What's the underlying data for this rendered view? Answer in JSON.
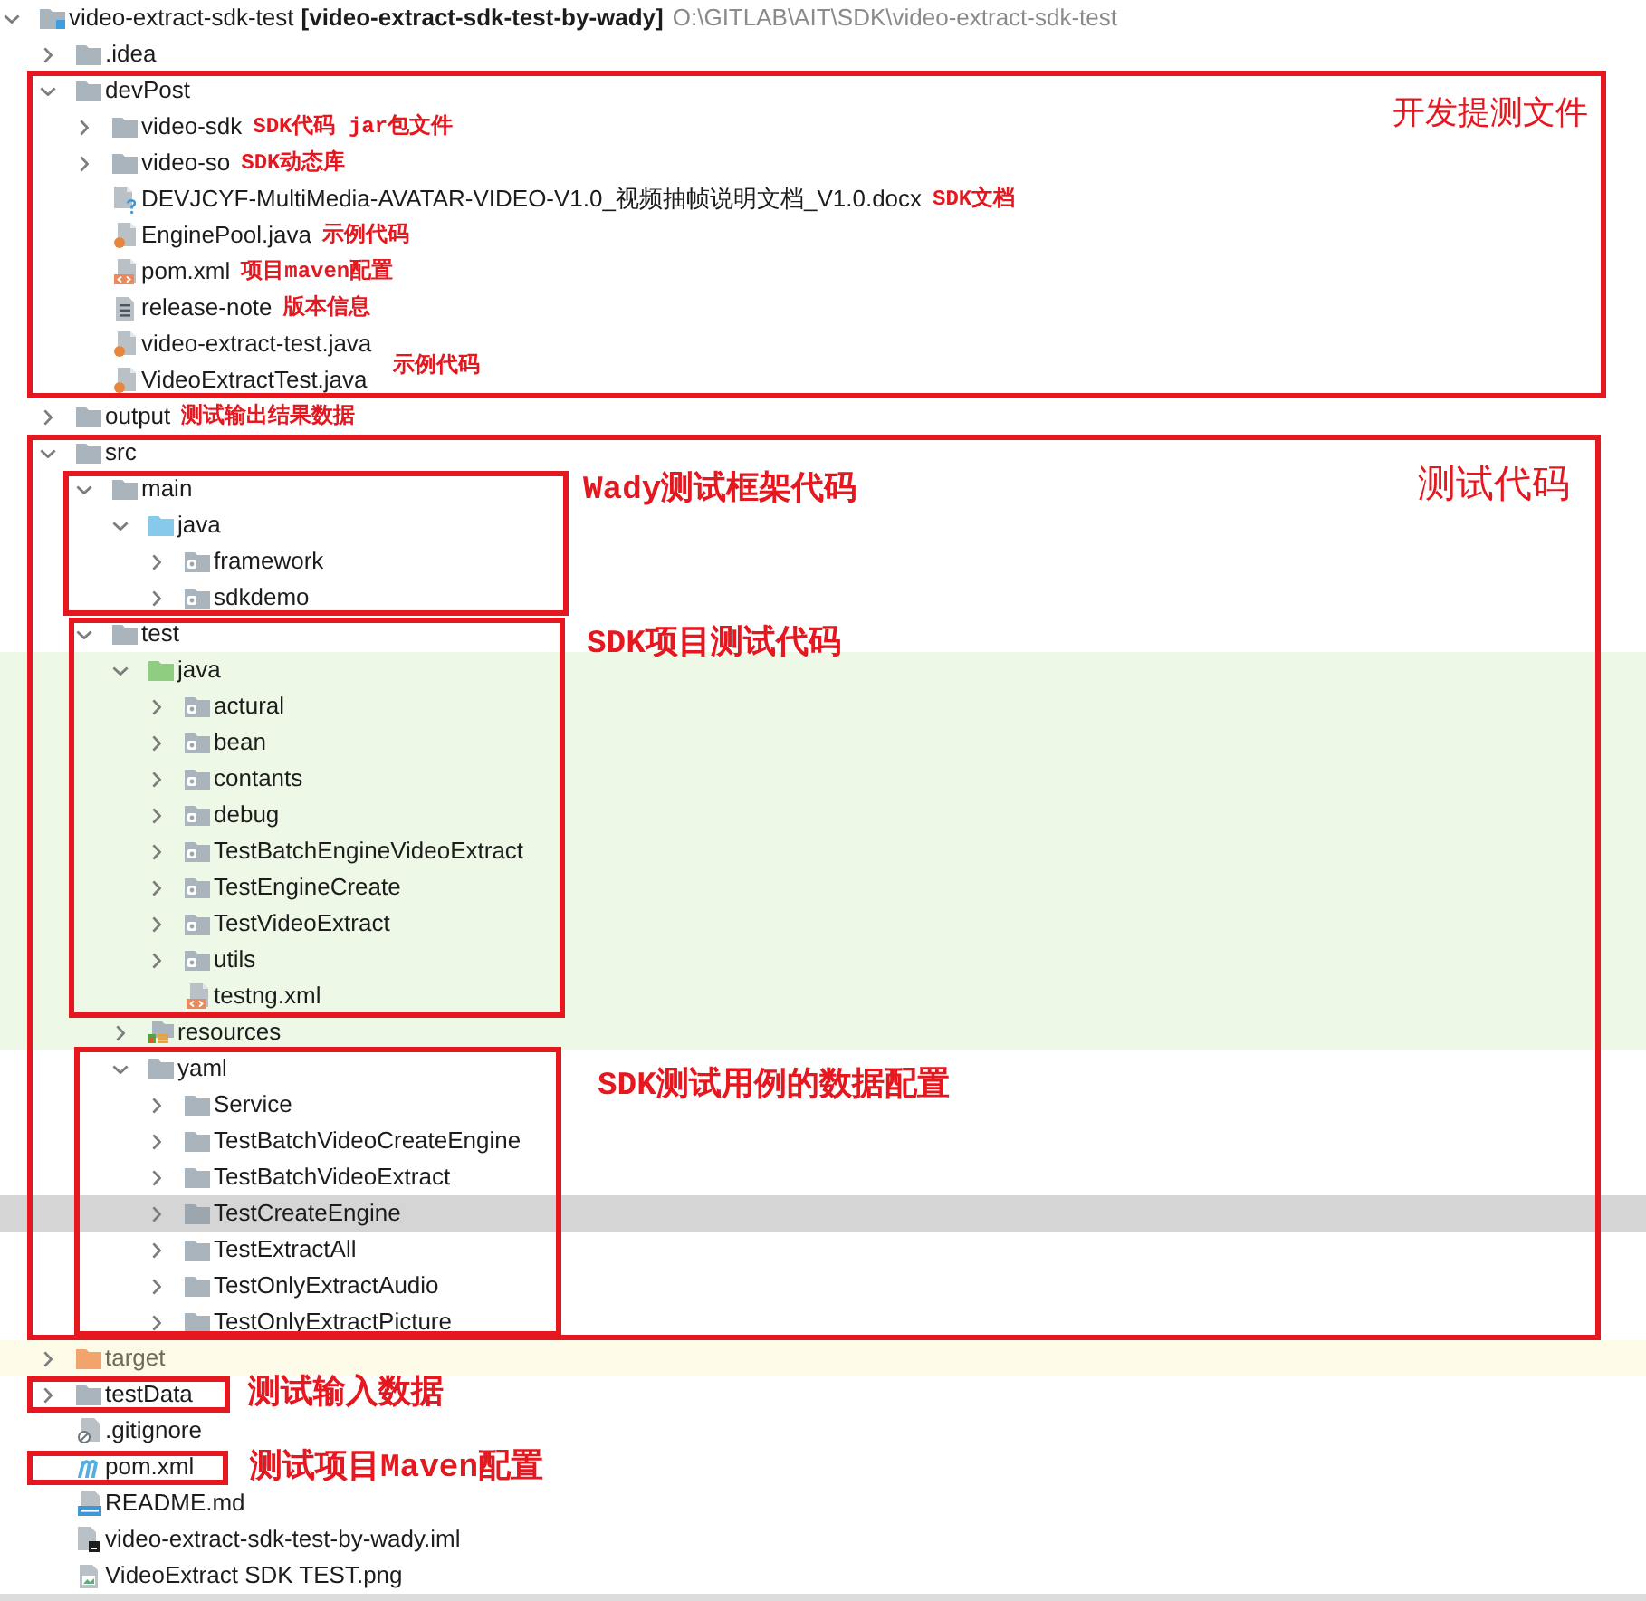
{
  "tree": {
    "name": "video-extract-sdk-test",
    "module": "[video-extract-sdk-test-by-wady]",
    "path": "O:\\GITLAB\\AIT\\SDK\\video-extract-sdk-test",
    "kind": "module",
    "expanded": true,
    "selected": false,
    "children": [
      {
        "name": ".idea",
        "kind": "folder",
        "expanded": false,
        "selected": false
      },
      {
        "name": "devPost",
        "kind": "folder",
        "expanded": true,
        "selected": false,
        "children": [
          {
            "name": "video-sdk",
            "kind": "folder",
            "expanded": false,
            "selected": false,
            "note": "SDK代码 jar包文件"
          },
          {
            "name": "video-so",
            "kind": "folder",
            "expanded": false,
            "selected": false,
            "note": "SDK动态库"
          },
          {
            "name": "DEVJCYF-MultiMedia-AVATAR-VIDEO-V1.0_视频抽帧说明文档_V1.0.docx",
            "kind": "unknown",
            "selected": false,
            "note": "SDK文档"
          },
          {
            "name": "EnginePool.java",
            "kind": "java",
            "selected": false,
            "note": "示例代码"
          },
          {
            "name": "pom.xml",
            "kind": "xml",
            "selected": false,
            "note": "项目maven配置"
          },
          {
            "name": "release-note",
            "kind": "text",
            "selected": false,
            "note": "版本信息"
          },
          {
            "name": "video-extract-test.java",
            "kind": "java",
            "selected": false
          },
          {
            "name": "VideoExtractTest.java",
            "kind": "java",
            "selected": false
          }
        ]
      },
      {
        "name": "output",
        "kind": "folder",
        "expanded": false,
        "selected": false,
        "note": "测试输出结果数据"
      },
      {
        "name": "src",
        "kind": "folder",
        "expanded": true,
        "selected": false,
        "children": [
          {
            "name": "main",
            "kind": "folder",
            "expanded": true,
            "selected": false,
            "children": [
              {
                "name": "java",
                "kind": "source-root",
                "expanded": true,
                "selected": false,
                "children": [
                  {
                    "name": "framework",
                    "kind": "package",
                    "expanded": false,
                    "selected": false
                  },
                  {
                    "name": "sdkdemo",
                    "kind": "package",
                    "expanded": false,
                    "selected": false
                  }
                ]
              }
            ]
          },
          {
            "name": "test",
            "kind": "folder",
            "expanded": true,
            "selected": false,
            "children": [
              {
                "name": "java",
                "kind": "test-root",
                "expanded": true,
                "selected": false,
                "children": [
                  {
                    "name": "actural",
                    "kind": "package",
                    "expanded": false,
                    "selected": false
                  },
                  {
                    "name": "bean",
                    "kind": "package",
                    "expanded": false,
                    "selected": false
                  },
                  {
                    "name": "contants",
                    "kind": "package",
                    "expanded": false,
                    "selected": false
                  },
                  {
                    "name": "debug",
                    "kind": "package",
                    "expanded": false,
                    "selected": false
                  },
                  {
                    "name": "TestBatchEngineVideoExtract",
                    "kind": "package",
                    "expanded": false,
                    "selected": false
                  },
                  {
                    "name": "TestEngineCreate",
                    "kind": "package",
                    "expanded": false,
                    "selected": false
                  },
                  {
                    "name": "TestVideoExtract",
                    "kind": "package",
                    "expanded": false,
                    "selected": false
                  },
                  {
                    "name": "utils",
                    "kind": "package",
                    "expanded": false,
                    "selected": false
                  },
                  {
                    "name": "testng.xml",
                    "kind": "xml",
                    "selected": false
                  }
                ]
              },
              {
                "name": "resources",
                "kind": "test-resources",
                "expanded": false,
                "selected": false
              },
              {
                "name": "yaml",
                "kind": "folder",
                "expanded": true,
                "selected": false,
                "children": [
                  {
                    "name": "Service",
                    "kind": "folder",
                    "expanded": false,
                    "selected": false
                  },
                  {
                    "name": "TestBatchVideoCreateEngine",
                    "kind": "folder",
                    "expanded": false,
                    "selected": false
                  },
                  {
                    "name": "TestBatchVideoExtract",
                    "kind": "folder",
                    "expanded": false,
                    "selected": false
                  },
                  {
                    "name": "TestCreateEngine",
                    "kind": "folder",
                    "expanded": false,
                    "selected": true
                  },
                  {
                    "name": "TestExtractAll",
                    "kind": "folder",
                    "expanded": false,
                    "selected": false
                  },
                  {
                    "name": "TestOnlyExtractAudio",
                    "kind": "folder",
                    "expanded": false,
                    "selected": false
                  },
                  {
                    "name": "TestOnlyExtractPicture",
                    "kind": "folder",
                    "expanded": false,
                    "selected": false
                  }
                ]
              }
            ]
          }
        ]
      },
      {
        "name": "target",
        "kind": "excluded",
        "expanded": false,
        "selected": false
      },
      {
        "name": "testData",
        "kind": "folder",
        "expanded": false,
        "selected": false
      },
      {
        "name": ".gitignore",
        "kind": "ignore",
        "selected": false
      },
      {
        "name": "pom.xml",
        "kind": "maven",
        "selected": false
      },
      {
        "name": "README.md",
        "kind": "markdown",
        "selected": false
      },
      {
        "name": "video-extract-sdk-test-by-wady.iml",
        "kind": "module-file",
        "selected": false
      },
      {
        "name": "VideoExtract SDK TEST.png",
        "kind": "image",
        "selected": false
      }
    ]
  },
  "annotations": [
    {
      "kind": "frame",
      "label": "开发提测文件"
    },
    {
      "kind": "callout",
      "label": "示例代码"
    },
    {
      "kind": "frame",
      "label": "测试代码"
    },
    {
      "kind": "frame",
      "label": "Wady测试框架代码"
    },
    {
      "kind": "frame",
      "label": "SDK项目测试代码"
    },
    {
      "kind": "frame",
      "label": "SDK测试用例的数据配置"
    },
    {
      "kind": "frame",
      "label": "测试输入数据"
    },
    {
      "kind": "frame",
      "label": "测试项目Maven配置"
    }
  ]
}
